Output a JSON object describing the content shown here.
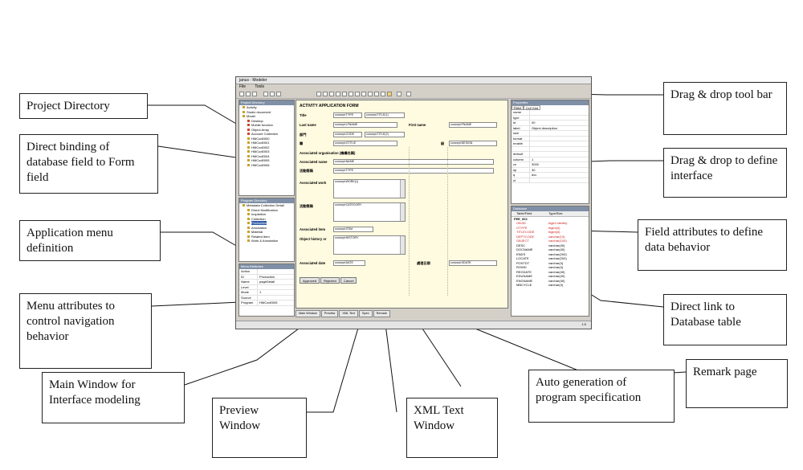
{
  "callouts": {
    "project_directory": "Project Directory",
    "direct_binding": "Direct binding of database field to Form field",
    "app_menu": "Application menu definition",
    "menu_attrs": "Menu attributes to control navigation behavior",
    "main_window": "Main Window for Interface modeling",
    "preview_window": "Preview Window",
    "xml_text_window": "XML Text Window",
    "auto_generation": "Auto generation of program specification",
    "remark_page": "Remark page",
    "dnd_toolbar": "Drag & drop tool bar",
    "dnd_interface": "Drag & drop to define interface",
    "field_attrs": "Field attributes to define data behavior",
    "direct_link_db": "Direct link to Database table"
  },
  "app": {
    "window_title": "janus - Modeler",
    "menu": [
      "File",
      "Tools"
    ],
    "project_pane_title": "Project Directory",
    "project_tree": [
      {
        "label": "Activity",
        "sub": false,
        "red": false
      },
      {
        "label": "Studio document",
        "sub": false,
        "red": false
      },
      {
        "label": "Model",
        "sub": false,
        "red": false
      },
      {
        "label": "Desktop",
        "sub": true,
        "red": true
      },
      {
        "label": "Mobile function",
        "sub": true,
        "red": true
      },
      {
        "label": "Object Array",
        "sub": true,
        "red": true
      },
      {
        "label": "Account Collection",
        "sub": true,
        "red": true
      },
      {
        "label": "HMCod0000",
        "sub": true,
        "red": false
      },
      {
        "label": "HMCod0001",
        "sub": true,
        "red": false
      },
      {
        "label": "HMCod0002",
        "sub": true,
        "red": false
      },
      {
        "label": "HMCod0003",
        "sub": true,
        "red": false
      },
      {
        "label": "HMCod0004",
        "sub": true,
        "red": false
      },
      {
        "label": "HMCod0005",
        "sub": true,
        "red": false
      },
      {
        "label": "HMCod0006",
        "sub": true,
        "red": false
      }
    ],
    "menu_pane_title": "Program Directory",
    "menu_tree": [
      {
        "label": "Metadata Collection Detail",
        "sub": false,
        "sel": false
      },
      {
        "label": "Direct Modification",
        "sub": true,
        "sel": false
      },
      {
        "label": "Inquisition",
        "sub": true,
        "sel": false
      },
      {
        "label": "Collection",
        "sub": true,
        "sel": false
      },
      {
        "label": "Production",
        "sub": true,
        "sel": true
      },
      {
        "label": "Annotation",
        "sub": true,
        "sel": false
      },
      {
        "label": "Material",
        "sub": true,
        "sel": false
      },
      {
        "label": "Related Item",
        "sub": true,
        "sel": false
      },
      {
        "label": "Work & Annotation",
        "sub": true,
        "sel": false
      }
    ],
    "menu_attr_title": "Menu Attributes",
    "menu_attrs": [
      {
        "k": "Action",
        "v": ""
      },
      {
        "k": "ID",
        "v": "Production"
      },
      {
        "k": "Name",
        "v": "pageDetail"
      },
      {
        "k": "Level",
        "v": ""
      },
      {
        "k": "Mode",
        "v": "1"
      },
      {
        "k": "Source",
        "v": ""
      },
      {
        "k": "Program",
        "v": "HMCod0005"
      }
    ],
    "form": {
      "title": "ACTIVITY APPLICATION FORM",
      "title_label": "Title",
      "title_values": [
        "concept:TYPE",
        "concept:TITLE(1)"
      ],
      "last_name_label": "Last name",
      "last_name_value": "concept:LFNAME",
      "first_name_label": "First name",
      "first_name_value": "concept:FNAME",
      "row3_label": "部門",
      "row3_values": [
        "concept:CODE",
        "concept:TITLE(2)"
      ],
      "row4_label": "職",
      "row4_value": "concept:OTITLE",
      "row4_label2": "級",
      "row4_value2": "concept:DESIGN",
      "assoc_org_label": "Associated organisation (機構名稱)",
      "assoc_name_label": "Associated name",
      "assoc_name_value": "concept:NAME",
      "row_ch_label": "活動簡稱",
      "row_ch_value": "concept:TYPE",
      "assoc_work_label": "Associated work",
      "assoc_work_value": "concept:WORK(1)",
      "activity_label": "活動簡稱",
      "activity_value": "concept:CATEGORY",
      "assoc_item_label": "Associated item",
      "assoc_item_value": "concept:ITEM",
      "object_label": "Object history or",
      "object_value": "concept:HISTORY",
      "assoc_date_label": "Associated date",
      "assoc_date_value": "concept:DATE",
      "handler_label": "處理日期",
      "handler_value": "concept:ODATE",
      "buttons": [
        "Approved",
        "Rejected",
        "Cancel"
      ]
    },
    "bottom_tabs": [
      "Main Window",
      "Preview",
      "XML Text",
      "Spec",
      "Remark"
    ],
    "status_text": "1:0",
    "properties_title": "Properties",
    "properties_tabs": [
      "Field",
      "Cell Grid"
    ],
    "properties": [
      {
        "k": "name",
        "v": ""
      },
      {
        "k": "type",
        "v": ""
      },
      {
        "k": "id",
        "v": "00"
      },
      {
        "k": "label",
        "v": "Object description"
      },
      {
        "k": "size",
        "v": ""
      },
      {
        "k": "format",
        "v": ""
      },
      {
        "k": "enable",
        "v": ""
      },
      {
        "k": "",
        "v": ""
      },
      {
        "k": "default",
        "v": ""
      },
      {
        "k": "column",
        "v": "1"
      },
      {
        "k": "cn",
        "v": "3000"
      },
      {
        "k": "sp",
        "v": "30"
      },
      {
        "k": "q",
        "v": "dvv"
      },
      {
        "k": "ct",
        "v": ""
      }
    ],
    "db_title": "Database",
    "db_header": [
      "Table/Field",
      "Type/Size"
    ],
    "db_table": "FEE_002",
    "db_rows": [
      {
        "f": "OBJID",
        "t": "bigint identity",
        "red": true
      },
      {
        "f": "OTYPE",
        "t": "bigint(4)",
        "red": true
      },
      {
        "f": "TITLECODE",
        "t": "bigint(4)",
        "red": true
      },
      {
        "f": "DEPTCODE",
        "t": "varchar(10)",
        "red": true
      },
      {
        "f": "OBJECT",
        "t": "varchar(100)",
        "red": true
      },
      {
        "f": "DESC",
        "t": "varchar(40)",
        "red": false
      },
      {
        "f": "DOCNAME",
        "t": "varchar(40)",
        "red": false
      },
      {
        "f": "ENDS",
        "t": "varchar(200)",
        "red": false
      },
      {
        "f": "LOCATE",
        "t": "varchar(200)",
        "red": false
      },
      {
        "f": "POSTDT",
        "t": "varchar(4)",
        "red": false
      },
      {
        "f": "ROWD",
        "t": "varchar(4)",
        "red": false
      },
      {
        "f": "REGDATE",
        "t": "varchar(40)",
        "red": false
      },
      {
        "f": "EDUNAME",
        "t": "varchar(40)",
        "red": false
      },
      {
        "f": "ENGNAME",
        "t": "varchar(40)",
        "red": false
      },
      {
        "f": "MBCYCLE",
        "t": "varchar(4)",
        "red": false
      }
    ]
  }
}
